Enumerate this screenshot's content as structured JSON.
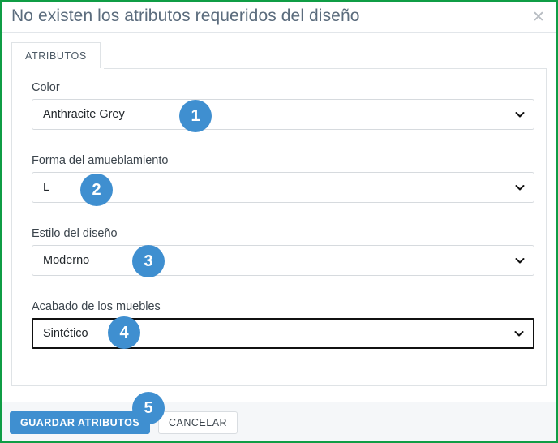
{
  "window": {
    "title": "No existen los atributos requeridos del diseño",
    "close_icon": "close-icon",
    "border_color": "#0f9d45"
  },
  "tabs": [
    {
      "label": "ATRIBUTOS",
      "active": true
    }
  ],
  "form": {
    "fields": [
      {
        "label": "Color",
        "value": "Anthracite Grey",
        "focused": false,
        "icon": "chevron-down-icon"
      },
      {
        "label": "Forma del amueblamiento",
        "value": "L",
        "focused": false,
        "icon": "chevron-down-icon"
      },
      {
        "label": "Estilo del diseño",
        "value": "Moderno",
        "focused": false,
        "icon": "chevron-down-icon"
      },
      {
        "label": "Acabado de los muebles",
        "value": "Sintético",
        "focused": true,
        "icon": "chevron-down-icon"
      }
    ]
  },
  "footer": {
    "save_label": "GUARDAR ATRIBUTOS",
    "cancel_label": "CANCELAR",
    "save_color": "#3f8fd0"
  },
  "annotations": {
    "badge_color": "#3f8fd0",
    "steps": [
      {
        "number": "1"
      },
      {
        "number": "2"
      },
      {
        "number": "3"
      },
      {
        "number": "4"
      },
      {
        "number": "5"
      }
    ]
  }
}
